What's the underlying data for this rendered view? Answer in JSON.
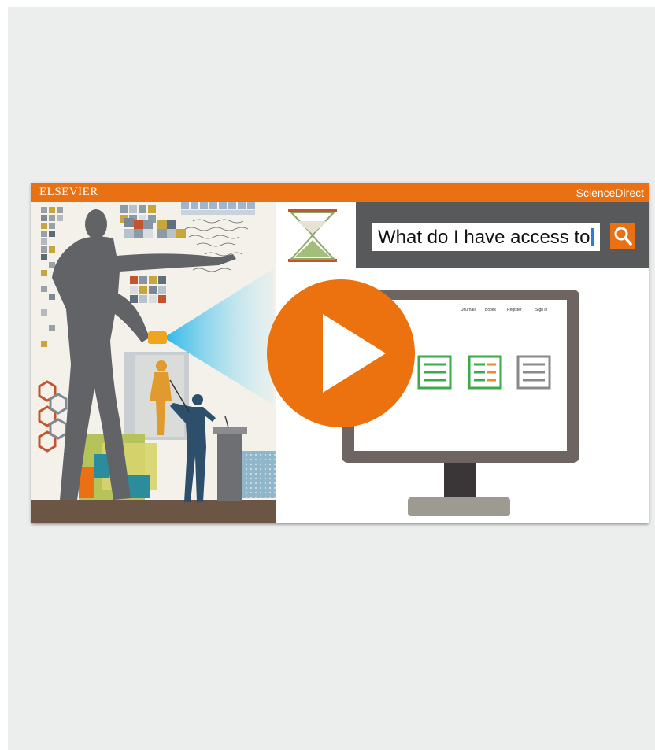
{
  "video": {
    "brand_left": "ELSEVIER",
    "brand_right": "ScienceDirect",
    "search_text": "What do I have access to",
    "play_icon": "play-icon",
    "search_icon": "search-icon",
    "screen_nav": [
      "Journals",
      "Books",
      "Register",
      "Sign in"
    ]
  },
  "colors": {
    "accent": "#ea7014",
    "panel": "#58595b",
    "background": "#eceeee"
  }
}
